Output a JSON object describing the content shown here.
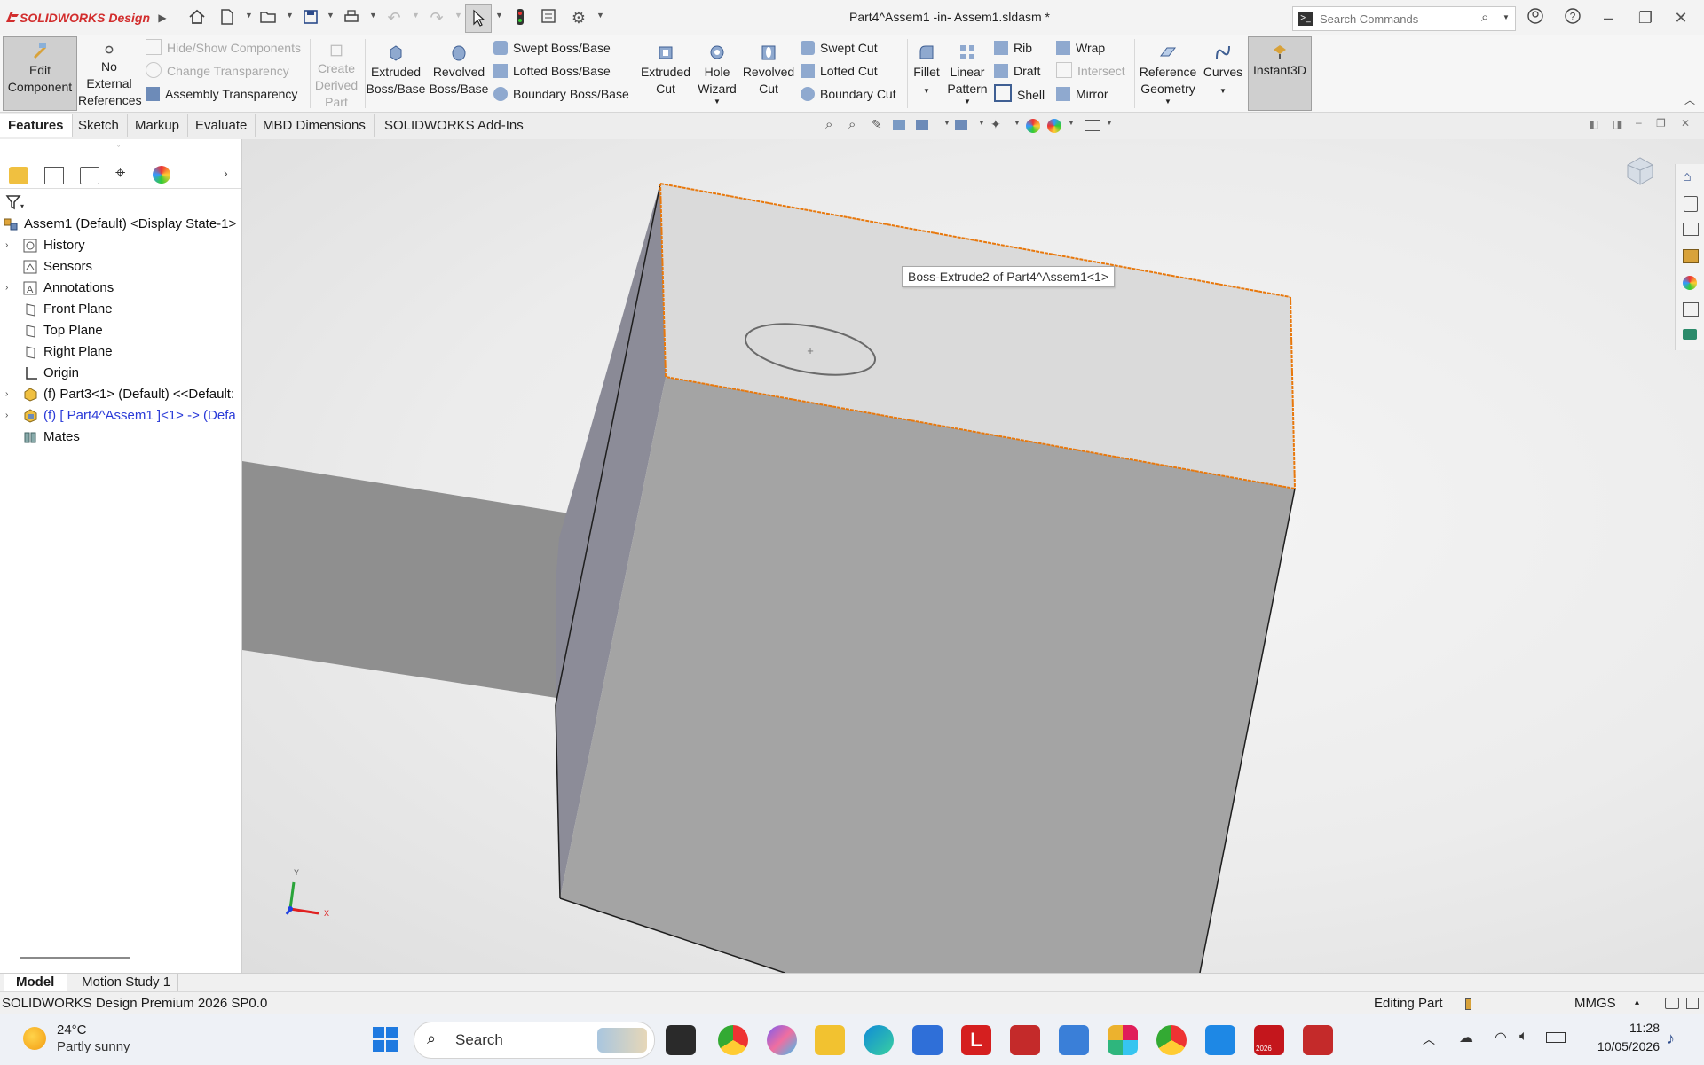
{
  "titlebar": {
    "brand": "SOLIDWORKS Design",
    "document_title": "Part4^Assem1 -in- Assem1.sldasm *",
    "search_placeholder": "Search Commands"
  },
  "ribbon": {
    "edit_component": [
      "Edit",
      "Component"
    ],
    "no_external_references": [
      "No",
      "External",
      "References"
    ],
    "hide_show_components": "Hide/Show Components",
    "change_transparency": "Change Transparency",
    "assembly_transparency": "Assembly Transparency",
    "create_derived_part": [
      "Create",
      "Derived",
      "Part"
    ],
    "extruded_boss_base": [
      "Extruded",
      "Boss/Base"
    ],
    "revolved_boss_base": [
      "Revolved",
      "Boss/Base"
    ],
    "swept_boss_base": "Swept Boss/Base",
    "lofted_boss_base": "Lofted Boss/Base",
    "boundary_boss_base": "Boundary Boss/Base",
    "extruded_cut": [
      "Extruded",
      "Cut"
    ],
    "hole_wizard": [
      "Hole",
      "Wizard"
    ],
    "revolved_cut": [
      "Revolved",
      "Cut"
    ],
    "swept_cut": "Swept Cut",
    "lofted_cut": "Lofted Cut",
    "boundary_cut": "Boundary Cut",
    "fillet": "Fillet",
    "linear_pattern": [
      "Linear",
      "Pattern"
    ],
    "rib": "Rib",
    "draft": "Draft",
    "shell": "Shell",
    "wrap": "Wrap",
    "intersect": "Intersect",
    "mirror": "Mirror",
    "reference_geometry": [
      "Reference",
      "Geometry"
    ],
    "curves": "Curves",
    "instant3d": "Instant3D"
  },
  "tabs": [
    "Features",
    "Sketch",
    "Markup",
    "Evaluate",
    "MBD Dimensions",
    "SOLIDWORKS Add-Ins"
  ],
  "tree": {
    "root": "Assem1 (Default) <Display State-1>",
    "items": [
      {
        "label": "History",
        "expandable": true
      },
      {
        "label": "Sensors",
        "expandable": false
      },
      {
        "label": "Annotations",
        "expandable": true
      },
      {
        "label": "Front Plane",
        "expandable": false
      },
      {
        "label": "Top Plane",
        "expandable": false
      },
      {
        "label": "Right Plane",
        "expandable": false
      },
      {
        "label": "Origin",
        "expandable": false
      },
      {
        "label": "(f) Part3<1> (Default) <<Default:",
        "expandable": true
      },
      {
        "label": "(f) [ Part4^Assem1 ]<1> -> (Defa",
        "expandable": true,
        "active": true
      },
      {
        "label": "Mates",
        "expandable": false
      }
    ]
  },
  "viewport": {
    "tooltip": "Boss-Extrude2 of Part4^Assem1<1>",
    "triad_y": "Y",
    "triad_x": "X"
  },
  "bottom_tabs": [
    "Model",
    "Motion Study 1"
  ],
  "status": {
    "product": "SOLIDWORKS Design Premium 2026 SP0.0",
    "mode": "Editing Part",
    "units": "MMGS"
  },
  "taskbar": {
    "temperature": "24°C",
    "weather": "Partly sunny",
    "search": "Search",
    "time": "11:28",
    "date": "10/05/2026",
    "sw_badge": "2026"
  },
  "colors": {
    "accent_red": "#d22d2d",
    "selection_orange": "#e8780c",
    "active_tree_blue": "#2a3ad8"
  }
}
